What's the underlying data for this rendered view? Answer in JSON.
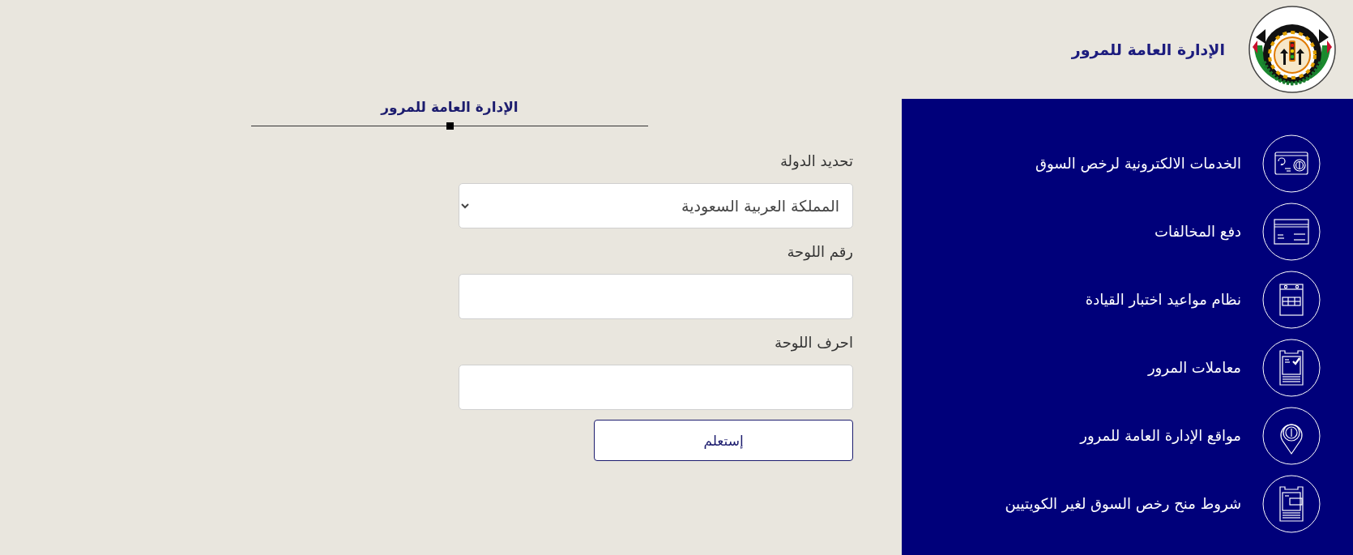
{
  "header": {
    "title": "الإدارة العامة للمرور"
  },
  "form": {
    "title": "الإدارة العامة للمرور",
    "fields": [
      {
        "kind": "select",
        "label": "تحديد الدولة",
        "value": "المملكة العربية السعودية"
      },
      {
        "kind": "text",
        "label": "رقم اللوحة"
      },
      {
        "kind": "text",
        "label": "احرف اللوحة"
      }
    ],
    "submit": "إستعلم"
  },
  "menu": [
    {
      "kind": "license",
      "label": "الخدمات الالكترونية لرخص السوق"
    },
    {
      "kind": "payment",
      "label": "دفع المخالفات"
    },
    {
      "kind": "calendar",
      "label": "نظام مواعيد اختبار القيادة"
    },
    {
      "kind": "checklist",
      "label": "معاملات المرور"
    },
    {
      "kind": "location",
      "label": "مواقع الإدارة العامة للمرور"
    },
    {
      "kind": "document",
      "label": "شروط منح رخص السوق لغير الكويتيين"
    }
  ]
}
